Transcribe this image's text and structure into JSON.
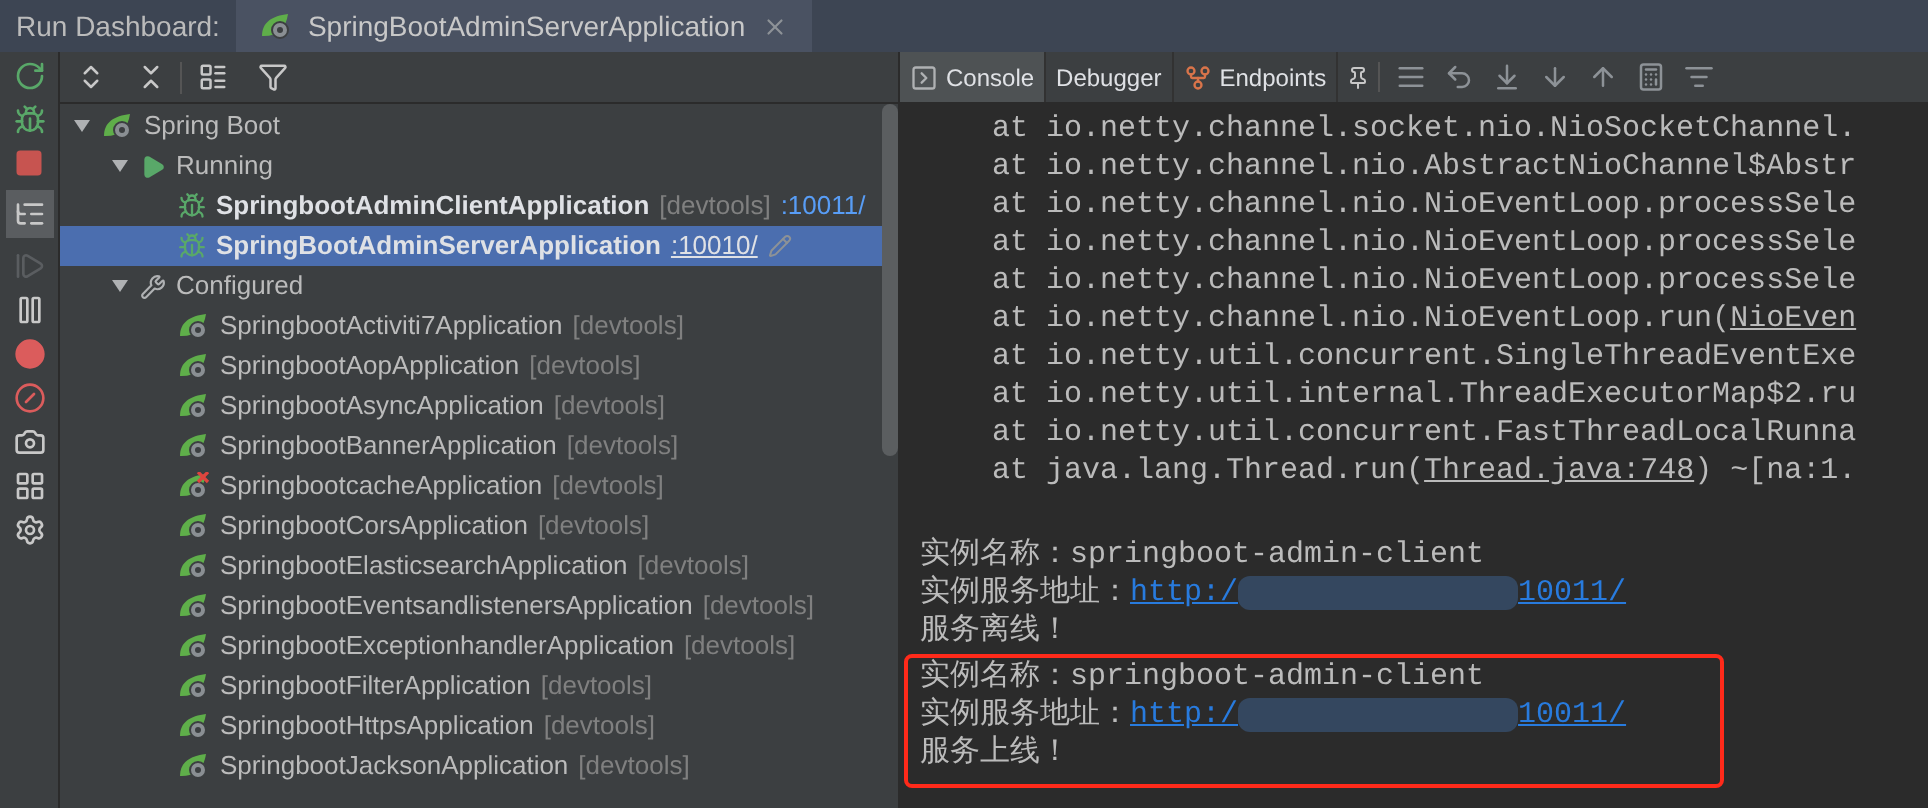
{
  "header": {
    "label": "Run Dashboard:",
    "tab": {
      "title": "SpringBootAdminServerApplication"
    }
  },
  "tree": [
    {
      "label": "Spring Boot",
      "kind": "group",
      "expanded": true,
      "selected": false,
      "children": [
        {
          "label": "Running",
          "kind": "running-group",
          "expanded": true,
          "selected": false,
          "children": [
            {
              "label": "SpringbootAdminClientApplication",
              "kind": "running",
              "suffix": "[devtools]",
              "port": ":10011/",
              "selected": false
            },
            {
              "label": "SpringBootAdminServerApplication",
              "kind": "running",
              "port": ":10010/",
              "selected": true
            }
          ]
        },
        {
          "label": "Configured",
          "kind": "configured-group",
          "expanded": true,
          "selected": false,
          "children": [
            {
              "label": "SpringbootActiviti7Application",
              "kind": "app",
              "suffix": "[devtools]",
              "error": false,
              "selected": false
            },
            {
              "label": "SpringbootAopApplication",
              "kind": "app",
              "suffix": "[devtools]",
              "error": false,
              "selected": false
            },
            {
              "label": "SpringbootAsyncApplication",
              "kind": "app",
              "suffix": "[devtools]",
              "error": false,
              "selected": false
            },
            {
              "label": "SpringbootBannerApplication",
              "kind": "app",
              "suffix": "[devtools]",
              "error": false,
              "selected": false
            },
            {
              "label": "SpringbootcacheApplication",
              "kind": "app",
              "suffix": "[devtools]",
              "error": true,
              "selected": false
            },
            {
              "label": "SpringbootCorsApplication",
              "kind": "app",
              "suffix": "[devtools]",
              "error": false,
              "selected": false
            },
            {
              "label": "SpringbootElasticsearchApplication",
              "kind": "app",
              "suffix": "[devtools]",
              "error": false,
              "selected": false
            },
            {
              "label": "SpringbootEventsandlistenersApplication",
              "kind": "app",
              "suffix": "[devtools]",
              "error": false,
              "selected": false
            },
            {
              "label": "SpringbootExceptionhandlerApplication",
              "kind": "app",
              "suffix": "[devtools]",
              "error": false,
              "selected": false
            },
            {
              "label": "SpringbootFilterApplication",
              "kind": "app",
              "suffix": "[devtools]",
              "error": false,
              "selected": false
            },
            {
              "label": "SpringbootHttpsApplication",
              "kind": "app",
              "suffix": "[devtools]",
              "error": false,
              "selected": false
            },
            {
              "label": "SpringbootJacksonApplication",
              "kind": "app",
              "suffix": "[devtools]",
              "error": false,
              "selected": false
            }
          ]
        }
      ]
    }
  ],
  "console_tabs": [
    {
      "label": "Console",
      "kind": "console",
      "selected": true
    },
    {
      "label": "Debugger",
      "kind": "debugger",
      "selected": false
    },
    {
      "label": "Endpoints",
      "kind": "endpoints",
      "selected": false
    }
  ],
  "console": {
    "lines": [
      {
        "text": "at io.netty.channel.socket.nio.NioSocketChannel."
      },
      {
        "text": "at io.netty.channel.nio.AbstractNioChannel$Abstr"
      },
      {
        "text": "at io.netty.channel.nio.NioEventLoop.processSele"
      },
      {
        "text": "at io.netty.channel.nio.NioEventLoop.processSele"
      },
      {
        "text": "at io.netty.channel.nio.NioEventLoop.processSele"
      },
      {
        "text": "at io.netty.channel.nio.NioEventLoop.run(",
        "link": "NioEven"
      },
      {
        "text": "at io.netty.util.concurrent.SingleThreadEventExe"
      },
      {
        "text": "at io.netty.util.internal.ThreadExecutorMap$2.ru"
      },
      {
        "text": "at io.netty.util.concurrent.FastThreadLocalRunna"
      },
      {
        "text": "at java.lang.Thread.run(",
        "link": "Thread.java:748",
        "after": ") ~[na:1."
      }
    ],
    "messages": [
      {
        "highlighted": false,
        "lines": [
          {
            "kind": "text",
            "text": "实例名称：springboot-admin-client"
          },
          {
            "kind": "url",
            "text": "实例服务地址：",
            "link_start": "http:/",
            "link_end": "10011/"
          },
          {
            "kind": "text",
            "text": "服务离线！"
          }
        ]
      },
      {
        "highlighted": true,
        "lines": [
          {
            "kind": "text",
            "text": "实例名称：springboot-admin-client"
          },
          {
            "kind": "url",
            "text": "实例服务地址：",
            "link_start": "http:/",
            "link_end": "10011/"
          },
          {
            "kind": "text",
            "text": "服务上线！"
          }
        ]
      }
    ]
  }
}
